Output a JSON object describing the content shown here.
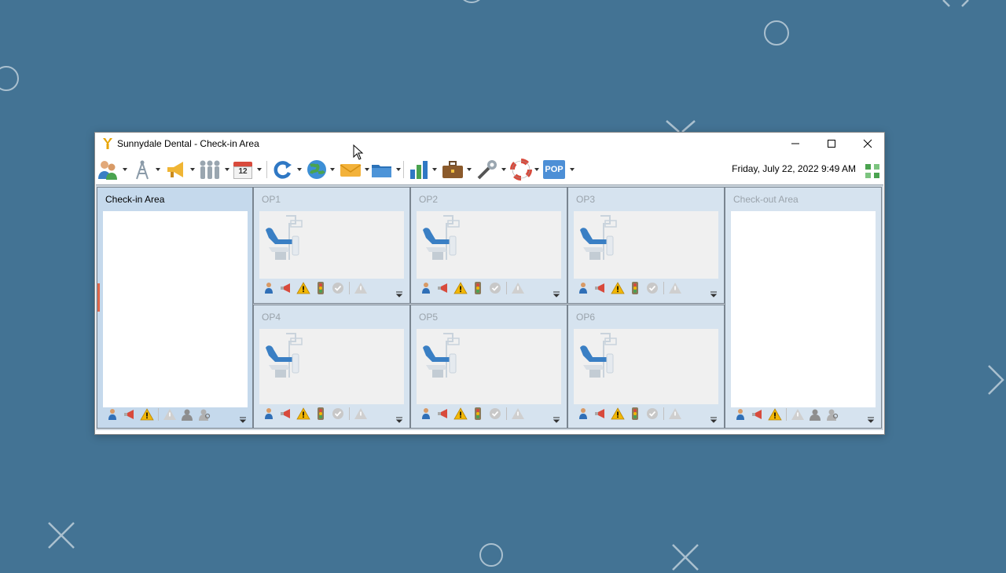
{
  "window": {
    "title": "Sunnydale Dental - Check-in Area",
    "datetime": "Friday, July 22, 2022 9:49 AM",
    "calendar_day": "12",
    "pop_label": "POP"
  },
  "toolbar": {
    "items": [
      "patients-icon",
      "signal-tower-icon",
      "megaphone-icon",
      "family-icon",
      "calendar-icon",
      "refresh-icon",
      "globe-icon",
      "email-icon",
      "folder-icon",
      "chart-icon",
      "briefcase-icon",
      "tools-icon",
      "lifebuoy-icon",
      "pop-icon"
    ]
  },
  "panels": {
    "checkin": {
      "title": "Check-in Area"
    },
    "op1": {
      "title": "OP1"
    },
    "op2": {
      "title": "OP2"
    },
    "op3": {
      "title": "OP3"
    },
    "op4": {
      "title": "OP4"
    },
    "op5": {
      "title": "OP5"
    },
    "op6": {
      "title": "OP6"
    },
    "checkout": {
      "title": "Check-out Area"
    }
  },
  "colors": {
    "desktop": "#437394",
    "panel": "#d6e3ef",
    "accent": "#2f6fb7",
    "warning": "#f2b705"
  }
}
